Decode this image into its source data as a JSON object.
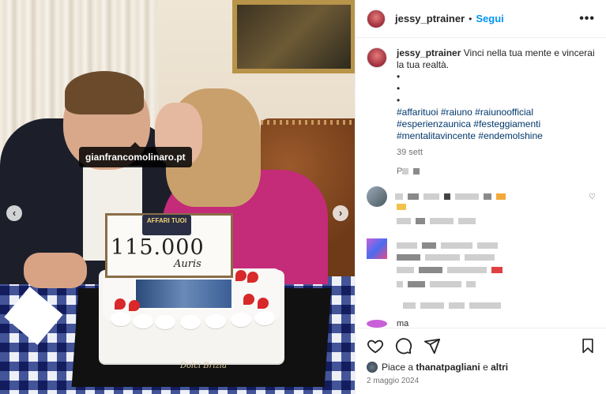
{
  "post": {
    "tag_label": "gianfrancomolinaro.pt",
    "sign": {
      "header": "AFFARI TUOI",
      "amount": "115.000",
      "sub": "Auris"
    },
    "cake_brand": "Dolci Brizia",
    "nav": {
      "prev": "‹",
      "next": "›"
    }
  },
  "header": {
    "username": "jessy_ptrainer",
    "separator": "•",
    "follow_label": "Segui",
    "more_label": "•••"
  },
  "caption": {
    "username": "jessy_ptrainer",
    "text": "Vinci nella tua mente e vincerai la tua realtà.",
    "bullets": [
      "•",
      "•",
      "•"
    ],
    "hashtag_lines": [
      "#affarituoi #raiuno #raiunoofficial",
      "#esperienzaunica #festeggiamenti",
      "#mentalitavincente #endemolshine"
    ],
    "time": "39 sett"
  },
  "comments": {
    "partial_label": "P",
    "last_partial": "ma"
  },
  "actions": {
    "icons": [
      "heart-icon",
      "comment-icon",
      "share-icon",
      "bookmark-icon"
    ],
    "likes_prefix": "Piace a",
    "likes_user": "thanatpagliani",
    "likes_and": "e",
    "likes_others": "altri",
    "date": "2 maggio 2024"
  },
  "colors": {
    "accent": "#0095f6",
    "hashtag": "#00376b",
    "text": "#262626",
    "muted": "#737373"
  }
}
